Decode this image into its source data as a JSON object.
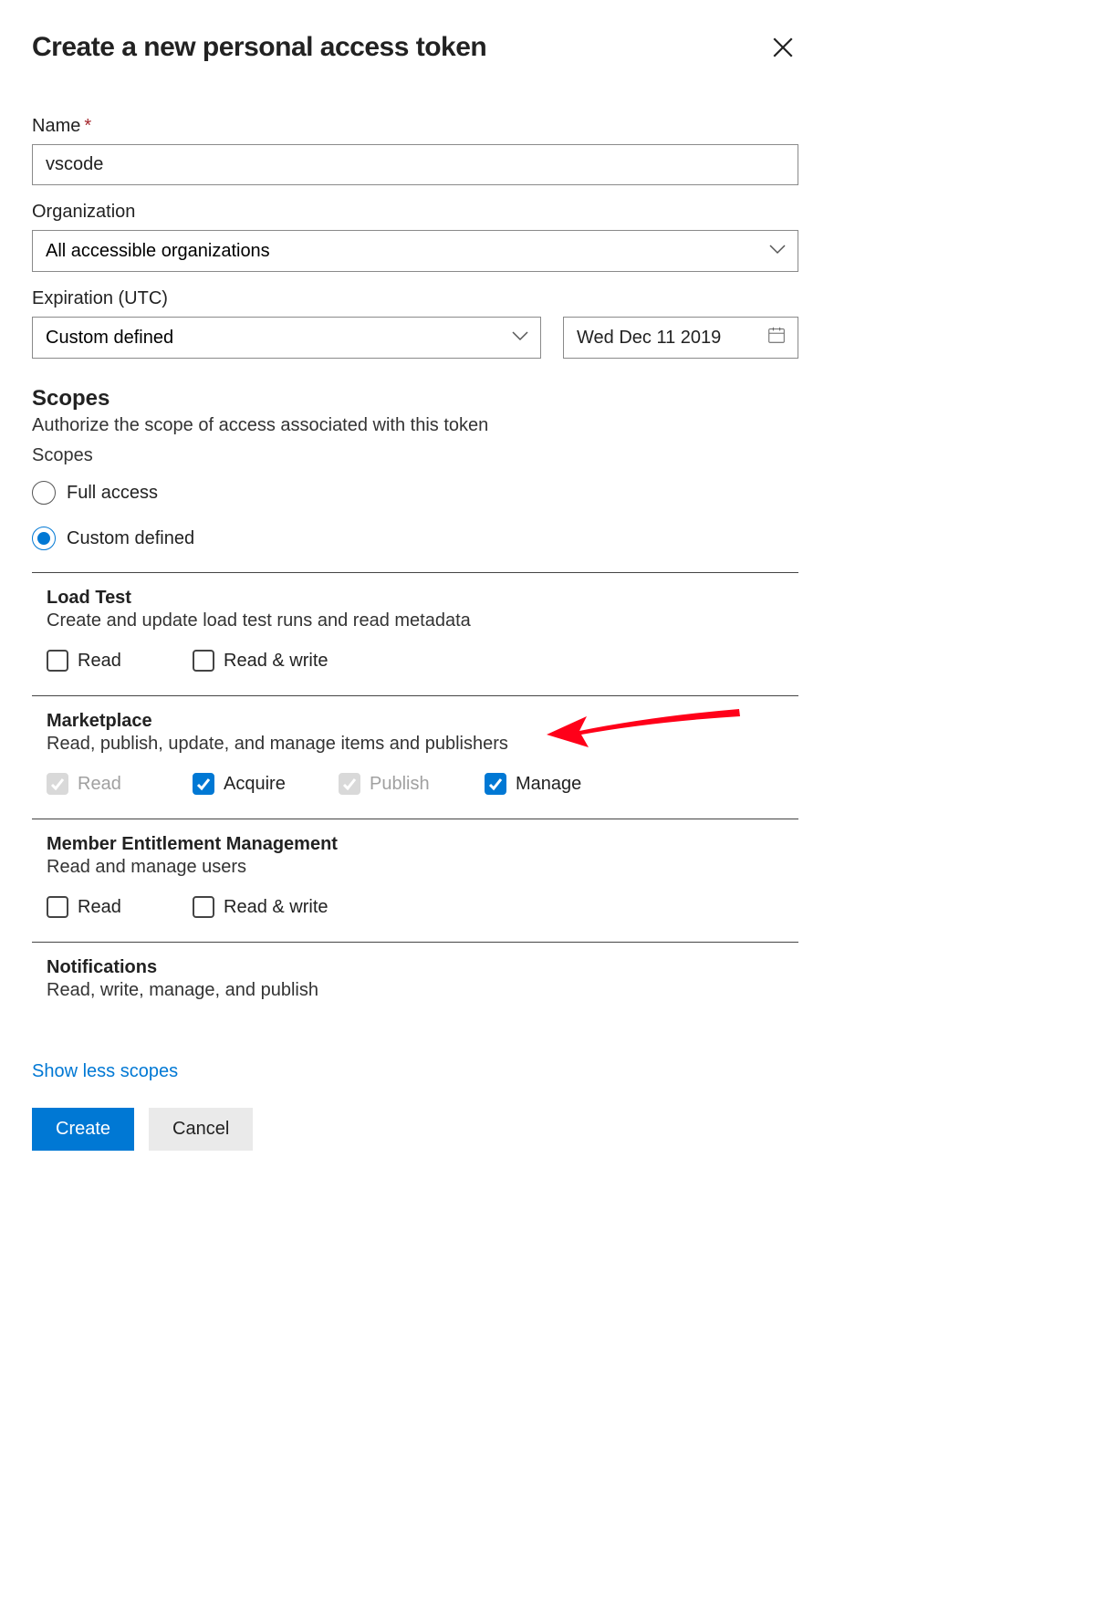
{
  "title": "Create a new personal access token",
  "fields": {
    "name": {
      "label": "Name",
      "value": "vscode",
      "required": true
    },
    "organization": {
      "label": "Organization",
      "value": "All accessible organizations"
    },
    "expiration": {
      "label": "Expiration (UTC)",
      "preset": "Custom defined",
      "date": "Wed Dec 11 2019"
    }
  },
  "scopes": {
    "heading": "Scopes",
    "subheading": "Authorize the scope of access associated with this token",
    "radio_label": "Scopes",
    "options": {
      "full": "Full access",
      "custom": "Custom defined"
    },
    "selected": "custom",
    "groups": [
      {
        "id": "load-test",
        "title": "Load Test",
        "desc": "Create and update load test runs and read metadata",
        "perms": [
          {
            "label": "Read",
            "state": "unchecked"
          },
          {
            "label": "Read & write",
            "state": "unchecked"
          }
        ]
      },
      {
        "id": "marketplace",
        "title": "Marketplace",
        "desc": "Read, publish, update, and manage items and publishers",
        "perms": [
          {
            "label": "Read",
            "state": "disabled-checked"
          },
          {
            "label": "Acquire",
            "state": "checked"
          },
          {
            "label": "Publish",
            "state": "disabled-checked"
          },
          {
            "label": "Manage",
            "state": "checked"
          }
        ]
      },
      {
        "id": "member-entitlement",
        "title": "Member Entitlement Management",
        "desc": "Read and manage users",
        "perms": [
          {
            "label": "Read",
            "state": "unchecked"
          },
          {
            "label": "Read & write",
            "state": "unchecked"
          }
        ]
      },
      {
        "id": "notifications",
        "title": "Notifications",
        "desc": "Read, write, manage, and publish",
        "perms": []
      }
    ]
  },
  "toggle_scopes": "Show less scopes",
  "footer": {
    "create": "Create",
    "cancel": "Cancel"
  }
}
